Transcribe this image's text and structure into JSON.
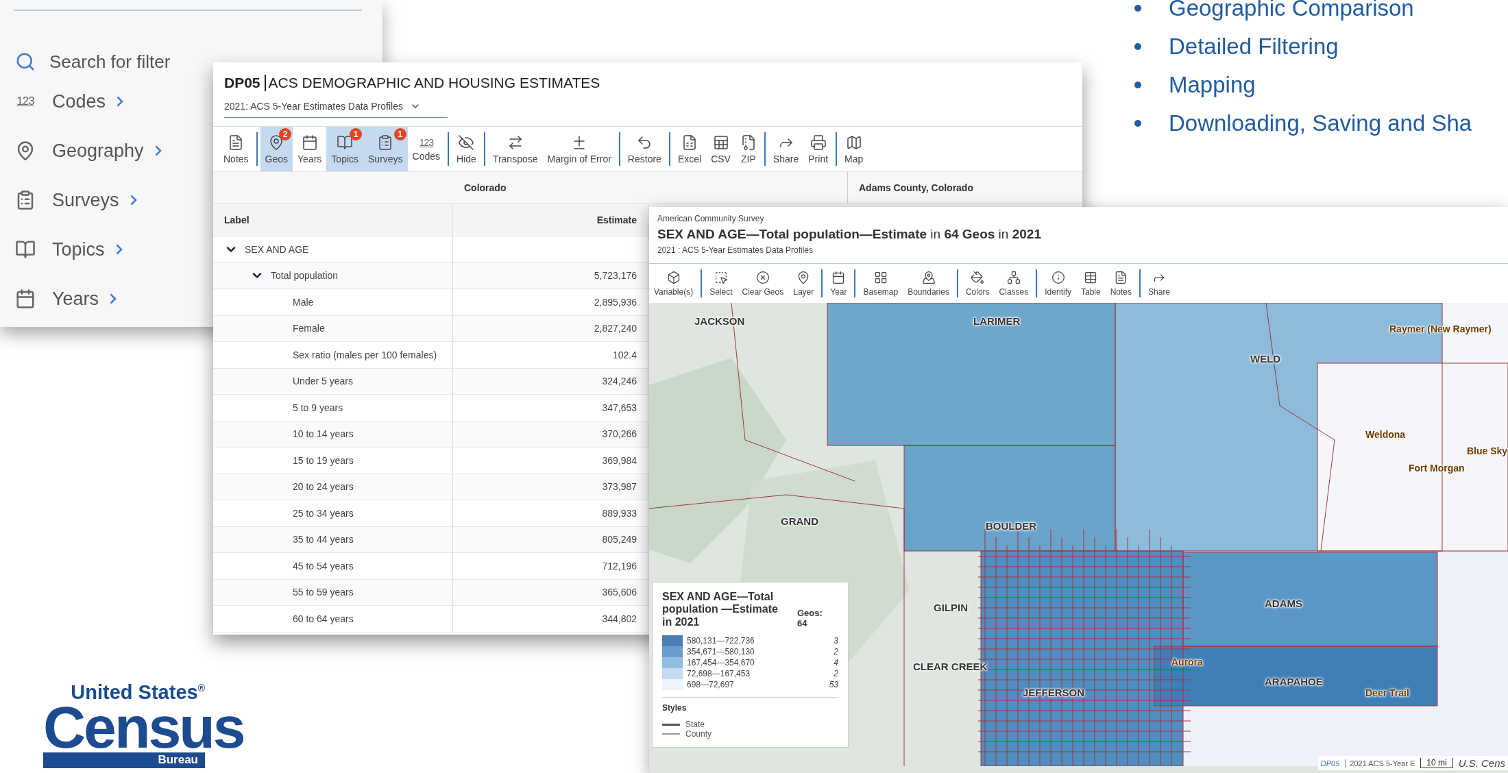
{
  "filter_panel": {
    "search": {
      "placeholder": "Search for filter"
    },
    "items": [
      {
        "label": "Codes",
        "icon_text": "123"
      },
      {
        "label": "Geography"
      },
      {
        "label": "Surveys"
      },
      {
        "label": "Topics"
      },
      {
        "label": "Years"
      }
    ]
  },
  "bullets": [
    "Geographic Comparison",
    "Detailed Filtering",
    "Mapping",
    "Downloading, Saving and Sha"
  ],
  "logo": {
    "line_1": "United States$^{®}$",
    "line_2": "Census",
    "line_3": "Bureau"
  },
  "table_window": {
    "code": "DP05",
    "title": "ACS DEMOGRAPHIC AND HOUSING ESTIMATES",
    "dataset": "2021: ACS 5-Year Estimates Data Profiles",
    "toolbar": [
      [
        {
          "label": "Notes",
          "selected": false
        }
      ],
      [
        {
          "label": "Geos",
          "selected": true,
          "badge": "2"
        },
        {
          "label": "Years",
          "selected": false
        },
        {
          "label": "Topics",
          "selected": true,
          "badge": "1"
        },
        {
          "label": "Surveys",
          "selected": true,
          "badge": "1"
        },
        {
          "label": "Codes",
          "selected": false,
          "icon_text": "123"
        }
      ],
      [
        {
          "label": "Hide",
          "selected": false
        }
      ],
      [
        {
          "label": "Transpose",
          "selected": false
        },
        {
          "label": "Margin of Error",
          "selected": false
        }
      ],
      [
        {
          "label": "Restore",
          "selected": false
        }
      ],
      [
        {
          "label": "Excel",
          "selected": false
        },
        {
          "label": "CSV",
          "selected": false
        },
        {
          "label": "ZIP",
          "selected": false
        }
      ],
      [
        {
          "label": "Share",
          "selected": false
        },
        {
          "label": "Print",
          "selected": false
        }
      ],
      [
        {
          "label": "Map",
          "selected": false
        }
      ]
    ],
    "column_groups": [
      "Colorado",
      "Adams County, Colorado"
    ],
    "columns": [
      "Label",
      "Estimate"
    ],
    "rows": [
      {
        "label": "SEX AND AGE",
        "expanded": true,
        "children": [
          {
            "label": "Total population",
            "estimate": "5,723,176",
            "expanded": true,
            "children": [
              {
                "label": "Male",
                "estimate": "2,895,936"
              },
              {
                "label": "Female",
                "estimate": "2,827,240"
              },
              {
                "label": "Sex ratio (males per 100 females)",
                "estimate": "102.4"
              },
              {
                "label": "Under 5 years",
                "estimate": "324,246"
              },
              {
                "label": "5 to 9 years",
                "estimate": "347,653"
              },
              {
                "label": "10 to 14 years",
                "estimate": "370,266"
              },
              {
                "label": "15 to 19 years",
                "estimate": "369,984"
              },
              {
                "label": "20 to 24 years",
                "estimate": "373,987"
              },
              {
                "label": "25 to 34 years",
                "estimate": "889,933"
              },
              {
                "label": "35 to 44 years",
                "estimate": "805,249"
              },
              {
                "label": "45 to 54 years",
                "estimate": "712,196"
              },
              {
                "label": "55 to 59 years",
                "estimate": "365,606"
              },
              {
                "label": "60 to 64 years",
                "estimate": "344,802"
              }
            ]
          }
        ]
      }
    ]
  },
  "map_window": {
    "source": "American Community Survey",
    "title": "**SEX AND AGE—Total population—Estimate** in **64 Geos**  in **2021**",
    "dataset": "2021 : ACS 5-Year Estimates Data Profiles",
    "toolbar": [
      [
        "Variable(s)"
      ],
      [
        "Select",
        "Clear Geos",
        "Layer"
      ],
      [
        "Year"
      ],
      [
        "Basemap",
        "Boundaries"
      ],
      [
        "Colors",
        "Classes"
      ],
      [
        "Identify",
        "Table",
        "Notes"
      ],
      [
        "Share"
      ]
    ],
    "map_labels": [
      {
        "text": "JACKSON",
        "kind": "county"
      },
      {
        "text": "LARIMER",
        "kind": "county"
      },
      {
        "text": "WELD",
        "kind": "county"
      },
      {
        "text": "Raymer (New Raymer)",
        "kind": "place"
      },
      {
        "text": "GRAND",
        "kind": "county"
      },
      {
        "text": "BOULDER",
        "kind": "county"
      },
      {
        "text": "GILPIN",
        "kind": "county"
      },
      {
        "text": "CLEAR CREEK",
        "kind": "county"
      },
      {
        "text": "ADAMS",
        "kind": "county"
      },
      {
        "text": "ARAPAHOE",
        "kind": "county"
      },
      {
        "text": "Aurora",
        "kind": "place"
      },
      {
        "text": "Deer Trail",
        "kind": "place"
      },
      {
        "text": "JEFFERSON",
        "kind": "county"
      },
      {
        "text": "Weldona",
        "kind": "place"
      },
      {
        "text": "Blue Sky",
        "kind": "place"
      },
      {
        "text": "Fort Morgan",
        "kind": "place"
      }
    ],
    "legend": {
      "title": "SEX AND AGE—Total population —Estimate in 2021",
      "geos_label": "Geos:",
      "geos_count": "64",
      "classes": [
        {
          "range": "580,131—722,736",
          "count": "3",
          "color": "#4c7fb6"
        },
        {
          "range": "354,671—580,130",
          "count": "2",
          "color": "#6a9bc9"
        },
        {
          "range": "167,454—354,670",
          "count": "4",
          "color": "#93bde0"
        },
        {
          "range": "72,698—167,453",
          "count": "2",
          "color": "#c3dcef"
        },
        {
          "range": "698—72,697",
          "count": "53",
          "color": "#eef4fb"
        }
      ],
      "styles_title": "Styles",
      "styles": [
        {
          "label": "State",
          "kind": "state"
        },
        {
          "label": "County",
          "kind": "county"
        }
      ]
    },
    "attribution": {
      "code": "DP05",
      "dataset": "2021 ACS 5-Year E",
      "scale": "10 mi",
      "credit": "U.S. Cens"
    }
  }
}
